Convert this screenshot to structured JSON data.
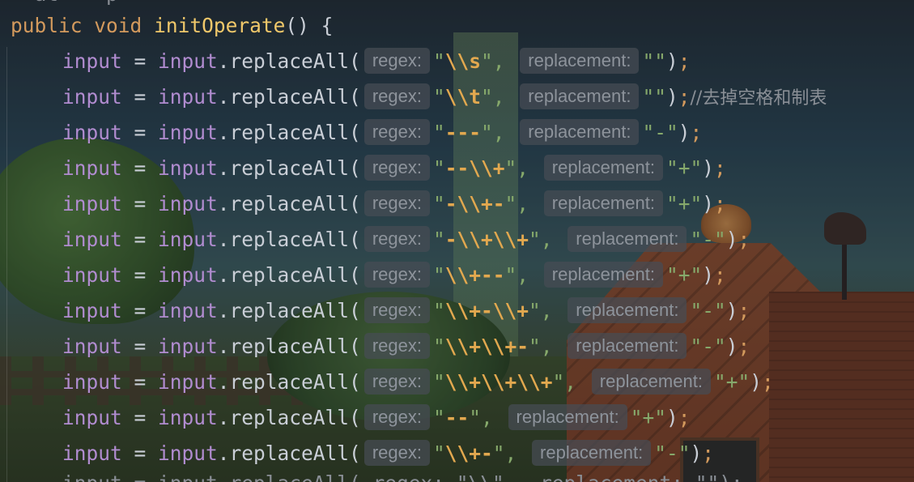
{
  "editor": {
    "top_partial_text": "  at    p",
    "method_line": {
      "kw_public": "public",
      "kw_void": "void",
      "name": "initOperate",
      "tail": "() {"
    },
    "lines": [
      {
        "lhs": "input",
        "rhs": "input",
        "method": ".replaceAll(",
        "regex_hint": "regex:",
        "pattern": "\\\\s",
        "repl_hint": "replacement:",
        "replacement": "",
        "comment": ""
      },
      {
        "lhs": "input",
        "rhs": "input",
        "method": ".replaceAll(",
        "regex_hint": "regex:",
        "pattern": "\\\\t",
        "repl_hint": "replacement:",
        "replacement": "",
        "comment": "//去掉空格和制表"
      },
      {
        "lhs": "input",
        "rhs": "input",
        "method": ".replaceAll(",
        "regex_hint": "regex:",
        "pattern": "---",
        "repl_hint": "replacement:",
        "replacement": "-",
        "comment": ""
      },
      {
        "lhs": "input",
        "rhs": "input",
        "method": ".replaceAll(",
        "regex_hint": "regex:",
        "pattern": "--\\\\+",
        "repl_hint": "replacement:",
        "replacement": "+",
        "comment": ""
      },
      {
        "lhs": "input",
        "rhs": "input",
        "method": ".replaceAll(",
        "regex_hint": "regex:",
        "pattern": "-\\\\+-",
        "repl_hint": "replacement:",
        "replacement": "+",
        "comment": ""
      },
      {
        "lhs": "input",
        "rhs": "input",
        "method": ".replaceAll(",
        "regex_hint": "regex:",
        "pattern": "-\\\\+\\\\+",
        "repl_hint": "replacement:",
        "replacement": "-",
        "comment": ""
      },
      {
        "lhs": "input",
        "rhs": "input",
        "method": ".replaceAll(",
        "regex_hint": "regex:",
        "pattern": "\\\\+--",
        "repl_hint": "replacement:",
        "replacement": "+",
        "comment": ""
      },
      {
        "lhs": "input",
        "rhs": "input",
        "method": ".replaceAll(",
        "regex_hint": "regex:",
        "pattern": "\\\\+-\\\\+",
        "repl_hint": "replacement:",
        "replacement": "-",
        "comment": ""
      },
      {
        "lhs": "input",
        "rhs": "input",
        "method": ".replaceAll(",
        "regex_hint": "regex:",
        "pattern": "\\\\+\\\\+-",
        "repl_hint": "replacement:",
        "replacement": "-",
        "comment": ""
      },
      {
        "lhs": "input",
        "rhs": "input",
        "method": ".replaceAll(",
        "regex_hint": "regex:",
        "pattern": "\\\\+\\\\+\\\\+",
        "repl_hint": "replacement:",
        "replacement": "+",
        "comment": ""
      },
      {
        "lhs": "input",
        "rhs": "input",
        "method": ".replaceAll(",
        "regex_hint": "regex:",
        "pattern": "--",
        "repl_hint": "replacement:",
        "replacement": "+",
        "comment": ""
      },
      {
        "lhs": "input",
        "rhs": "input",
        "method": ".replaceAll(",
        "regex_hint": "regex:",
        "pattern": "\\\\+-",
        "repl_hint": "replacement:",
        "replacement": "-",
        "comment": ""
      }
    ],
    "bottom_partial_text": "input = input.replaceAll( regex: \"\\\\\",  replacement: \"\");"
  },
  "colors": {
    "keyword": "#d39a5d",
    "function": "#f0c86a",
    "variable": "#b18cd0",
    "string": "#86a96b",
    "escape": "#e2a84f",
    "hint_bg": "#464c54"
  }
}
